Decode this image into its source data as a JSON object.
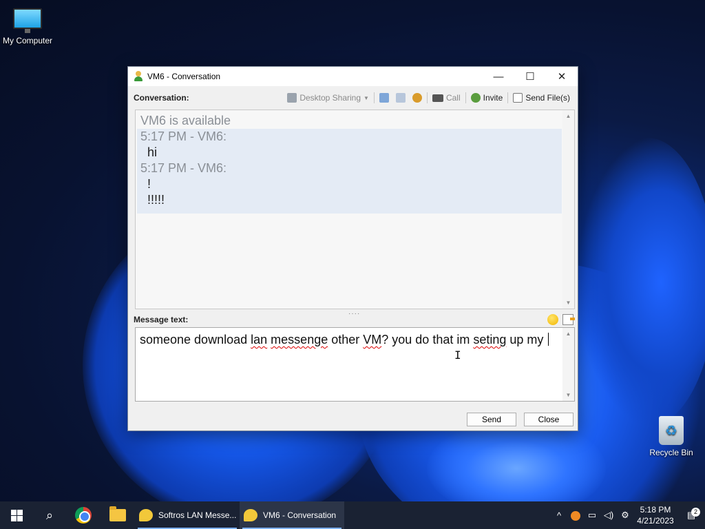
{
  "desktop": {
    "icons": [
      {
        "label": "My Computer",
        "icon": "monitor-icon"
      },
      {
        "label": "Recycle Bin",
        "icon": "recycle-bin-icon"
      }
    ]
  },
  "window": {
    "title": "VM6 - Conversation",
    "title_icon": "user-icon",
    "controls": {
      "minimize": "—",
      "maximize": "☐",
      "close": "✕"
    }
  },
  "toolbar": {
    "conversation_label": "Conversation:",
    "desktop_sharing": "Desktop Sharing",
    "call": "Call",
    "invite": "Invite",
    "send_files": "Send File(s)"
  },
  "conversation": {
    "status": "VM6 is available",
    "messages": [
      {
        "header": "5:17 PM - VM6:",
        "lines": [
          "hi"
        ]
      },
      {
        "header": "5:17 PM - VM6:",
        "lines": [
          "!",
          "!!!!!"
        ]
      }
    ]
  },
  "message": {
    "label": "Message text:",
    "text_words": [
      "someone download ",
      "lan",
      " ",
      "messenge",
      " other ",
      "VM",
      "? you do that im ",
      "seting",
      " up my "
    ]
  },
  "buttons": {
    "send": "Send",
    "close": "Close"
  },
  "taskbar": {
    "tasks": [
      {
        "label": "Softros LAN Messe...",
        "active": false
      },
      {
        "label": "VM6 - Conversation",
        "active": true
      }
    ],
    "clock": {
      "time": "5:18 PM",
      "date": "4/21/2023"
    },
    "notification_count": "2"
  }
}
